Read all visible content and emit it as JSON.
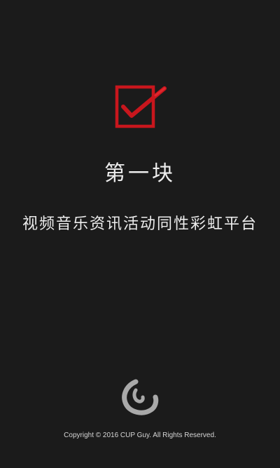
{
  "splash": {
    "logo_icon": "red-checkbox-check-icon",
    "headline": "第一块",
    "tagline": "视频音乐资讯活动同性彩虹平台",
    "bottom_icon": "spiral-swirl-icon",
    "copyright": "Copyright © 2016 CUP Guy. All Rights Reserved."
  },
  "colors": {
    "background": "#1b1b1b",
    "accent_red": "#c8161d",
    "text": "#ededed",
    "swirl_gray": "#a9a9a9"
  }
}
